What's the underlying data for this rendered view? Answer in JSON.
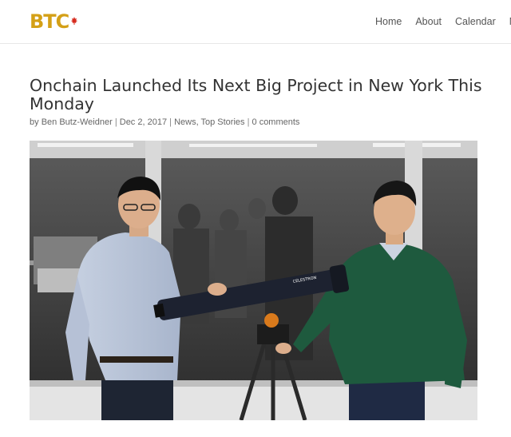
{
  "header": {
    "logo_text": "BTC",
    "nav": [
      "Home",
      "About",
      "Calendar",
      "Ne"
    ]
  },
  "post": {
    "title": "Onchain Launched Its Next Big Project in New York This Monday",
    "meta": {
      "by": "by",
      "author": "Ben Butz-Weidner",
      "separator": "|",
      "date": "Dec 2, 2017",
      "categories": [
        "News",
        "Top Stories"
      ],
      "category_separator": ",",
      "comments": "0 comments"
    },
    "image": {
      "telescope_label": "CELESTRON"
    }
  },
  "colors": {
    "logo_gold": "#d4a017",
    "maple_red": "#d62b1e",
    "text": "#333333",
    "meta": "#666666"
  }
}
